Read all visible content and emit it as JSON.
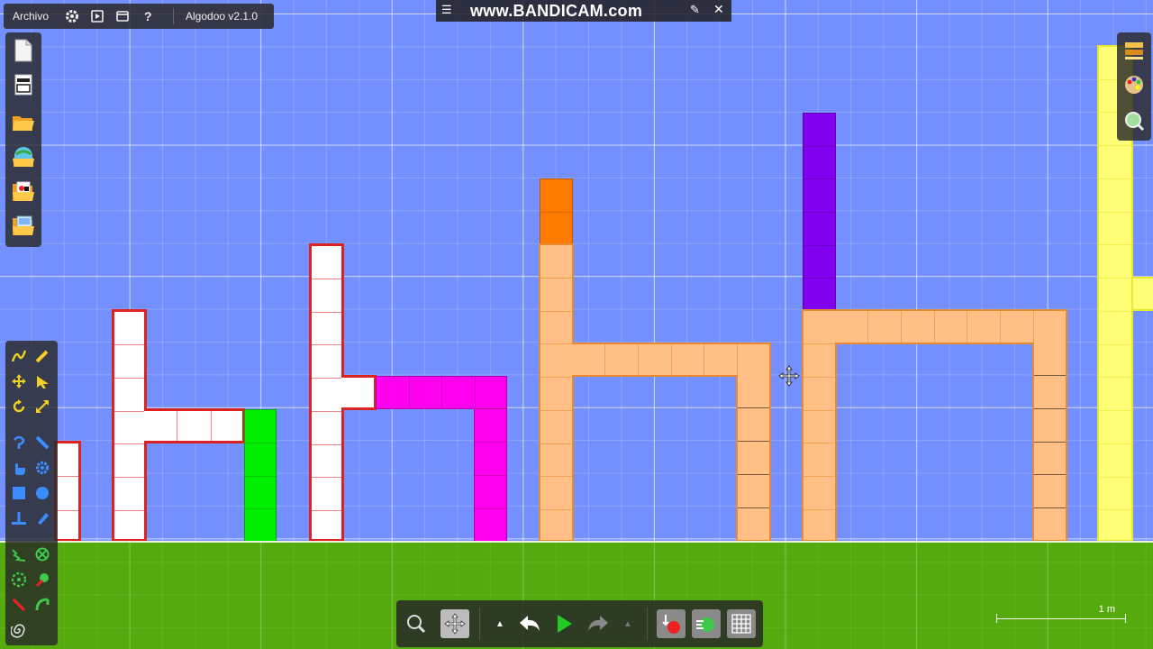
{
  "menu": {
    "archivo_label": "Archivo",
    "app_title": "Algodoo v2.1.0"
  },
  "recorder": {
    "watermark": "www.BANDICAM.com"
  },
  "left_toolbar": {
    "file_tools": [
      "new-scene",
      "scene-properties",
      "open-folder",
      "scenery-globe",
      "phunlets",
      "save-folder"
    ],
    "drawing_tools": [
      "sketch-tool",
      "pencil-tool",
      "move-tool",
      "drag-tool",
      "rotate-tool",
      "scale-tool",
      "rope-tool",
      "knife-tool",
      "hand-tool",
      "gear-tool",
      "box-tool",
      "circle-tool",
      "plane-tool",
      "brush-tool",
      "spring-tool",
      "fixate-tool",
      "hinge-tool",
      "tracer-tool",
      "laser-tool",
      "chain-tool",
      "gravity-tool"
    ]
  },
  "right_toolbar": {
    "items": [
      "layers-tool",
      "palette-tool",
      "zoom-tool"
    ]
  },
  "bottom_toolbar": {
    "items": [
      "zoom-tool",
      "pan-tool",
      "undo-menu",
      "undo",
      "play",
      "redo",
      "redo-menu",
      "gravity-toggle",
      "air-friction-toggle",
      "grid-toggle"
    ]
  },
  "scale_bar": {
    "label": "1 m"
  },
  "colors": {
    "sky": "#7490ff",
    "ground": "#55ab0e",
    "white_blocks": "#ffffff",
    "red_outline": "#dd2222",
    "green_blocks": "#00ee00",
    "magenta_blocks": "#ff00ee",
    "peach_blocks": "#ffbf85",
    "orange_blocks": "#ff7a00",
    "purple_blocks": "#8200f0",
    "yellow_blocks": "#ffff77"
  }
}
